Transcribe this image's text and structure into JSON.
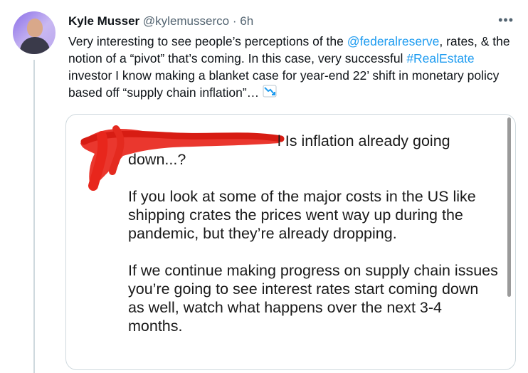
{
  "tweet": {
    "author_name": "Kyle Musser",
    "handle": "@kylemusserco",
    "separator": "·",
    "time": "6h",
    "more": "•••",
    "text_part1": "Very interesting to see people’s perceptions of the ",
    "mention": "@federalreserve",
    "text_part2": ", rates, & the notion of a “pivot” that’s coming. In this case, very successful ",
    "hashtag": "#RealEstate",
    "text_part3": " investor I know making a blanket case for year-end 22’ shift in monetary policy based off “supply chain inflation”… ",
    "emoji_icon": "chart-decreasing-icon"
  },
  "media": {
    "line1": "l Is inflation already going",
    "line1b": "down...?",
    "para2": "If you look at some of the major costs in the US like shipping crates the prices went way up during the pandemic, but they’re already dropping.",
    "para3": "If we continue making progress on supply chain issues you’re going to see interest rates start coming down as well, watch what happens over the next 3-4 months."
  },
  "colors": {
    "link": "#1d9bf0",
    "redaction": "#e8261c",
    "muted": "#536471"
  }
}
